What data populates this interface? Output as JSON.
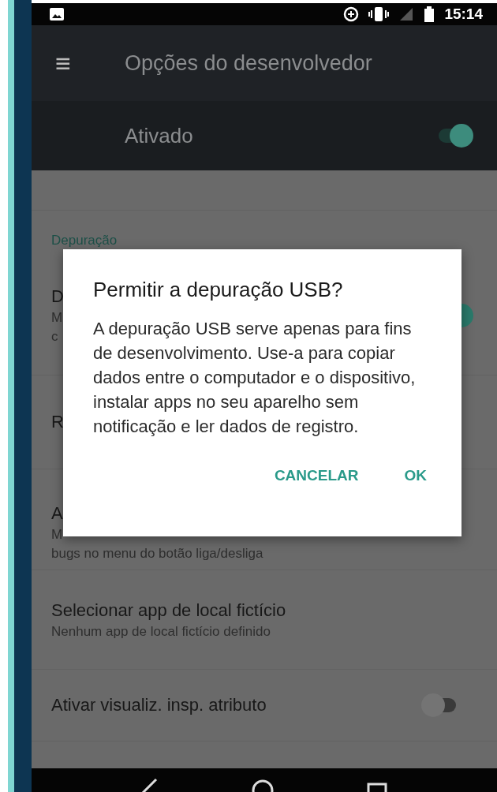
{
  "status_bar": {
    "time": "15:14"
  },
  "toolbar": {
    "menu_icon": "≡",
    "title": "Opções do desenvolvedor"
  },
  "master_switch": {
    "label": "Ativado",
    "on": true
  },
  "list": {
    "header": "Depuração",
    "rows": [
      {
        "kind": "switch",
        "title": "D",
        "subtitle_lines": [
          "M",
          "c"
        ],
        "on": true
      },
      {
        "kind": "plain",
        "title": "R",
        "subtitle_lines": []
      },
      {
        "kind": "plain",
        "title": "A",
        "subtitle_lines": [
          "M",
          "bugs no menu do botão liga/desliga"
        ]
      },
      {
        "kind": "plain",
        "title": "Selecionar app de local fictício",
        "subtitle_lines": [
          "Nenhum app de local fictício definido"
        ]
      },
      {
        "kind": "switch",
        "title": "Ativar visualiz. insp. atributo",
        "subtitle_lines": [],
        "on": false
      }
    ]
  },
  "dialog": {
    "title": "Permitir a depuração USB?",
    "message": "A depuração USB serve apenas para fins de desenvolvimento. Use-a para copiar dados entre o computador e o dispositivo, instalar apps no seu aparelho sem notificação e ler dados de registro.",
    "buttons": [
      "CANCELAR",
      "OK"
    ]
  }
}
